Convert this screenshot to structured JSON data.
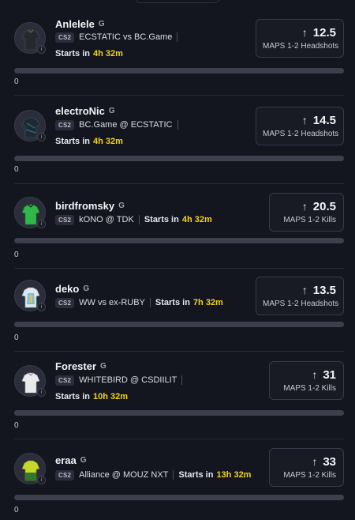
{
  "cards": [
    {
      "player": "Anlelele",
      "league": "G",
      "game": "CS2",
      "match": "ECSTATIC vs BC.Game",
      "starts_label": "Starts in",
      "starts_time": "4h 32m",
      "stat_value": "12.5",
      "stat_label": "MAPS 1-2 Headshots",
      "progress": 0,
      "count": "0",
      "jersey": "#2d2f36"
    },
    {
      "player": "electroNic",
      "league": "G",
      "game": "CS2",
      "match": "BC.Game @ ECSTATIC",
      "starts_label": "Starts in",
      "starts_time": "4h 32m",
      "stat_value": "14.5",
      "stat_label": "MAPS 1-2 Headshots",
      "progress": 0,
      "count": "0",
      "jersey": "#1f2f3a"
    },
    {
      "player": "birdfromsky",
      "league": "G",
      "game": "CS2",
      "match": "kONO @ TDK",
      "starts_label": "Starts in",
      "starts_time": "4h 32m",
      "stat_value": "20.5",
      "stat_label": "MAPS 1-2 Kills",
      "progress": 0,
      "count": "0",
      "jersey": "#2fb84a"
    },
    {
      "player": "deko",
      "league": "G",
      "game": "CS2",
      "match": "WW vs ex-RUBY",
      "starts_label": "Starts in",
      "starts_time": "7h 32m",
      "stat_value": "13.5",
      "stat_label": "MAPS 1-2 Headshots",
      "progress": 0,
      "count": "0",
      "jersey": "#9fd6e8"
    },
    {
      "player": "Forester",
      "league": "G",
      "game": "CS2",
      "match": "WHITEBIRD @ CSDIILIT",
      "starts_label": "Starts in",
      "starts_time": "10h 32m",
      "stat_value": "31",
      "stat_label": "MAPS 1-2 Kills",
      "progress": 0,
      "count": "0",
      "jersey": "#e8e8ec"
    },
    {
      "player": "eraa",
      "league": "G",
      "game": "CS2",
      "match": "Alliance @ MOUZ NXT",
      "starts_label": "Starts in",
      "starts_time": "13h 32m",
      "stat_value": "33",
      "stat_label": "MAPS 1-2 Kills",
      "progress": 0,
      "count": "0",
      "jersey": "#c8d82a"
    }
  ],
  "icons": {
    "arrow": "arrow-up-icon",
    "avatar": "jersey-icon",
    "info": "info-icon"
  },
  "colors": {
    "accent": "#f2d21b",
    "background": "#14161f",
    "card_border": "#363a4a"
  }
}
